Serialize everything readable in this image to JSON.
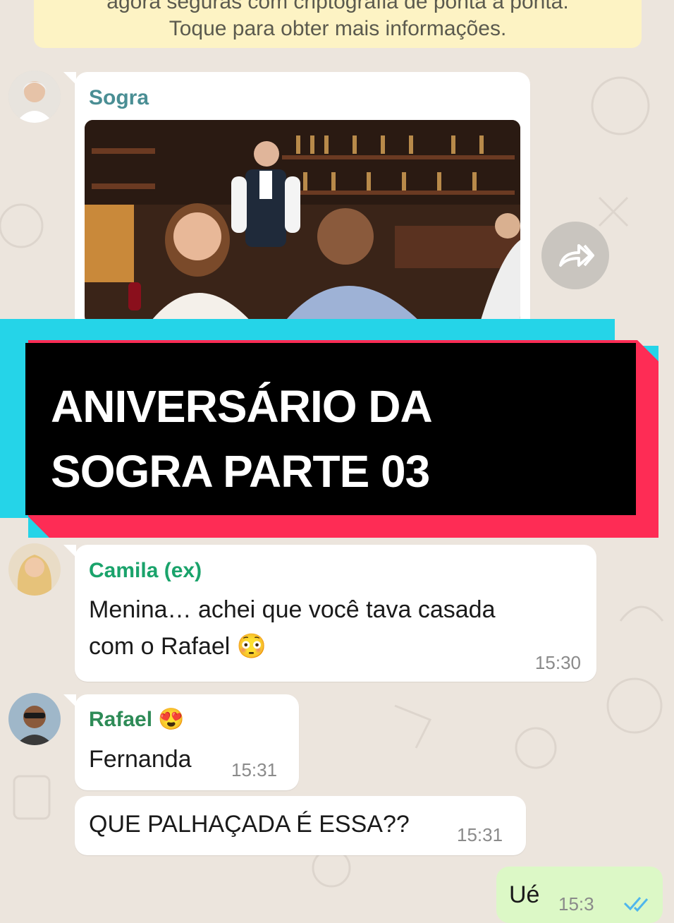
{
  "notice": {
    "line1": "agora seguras com criptografia de ponta a ponta.",
    "line2": "Toque para obter mais informações."
  },
  "messages": [
    {
      "sender": "Sogra",
      "type": "image"
    },
    {
      "sender": "Camila (ex)",
      "text_line1": "Menina… achei que você tava casada",
      "text_line2": "com o Rafael 😳",
      "time": "15:30"
    },
    {
      "sender": "Rafael 😍",
      "text": "Fernanda",
      "time": "15:31"
    },
    {
      "text": "QUE PALHAÇADA É ESSA??",
      "time": "15:31"
    },
    {
      "text": "Ué",
      "time": "15:3"
    }
  ],
  "banner": {
    "line1": "ANIVERSÁRIO DA",
    "line2": "SOGRA PARTE 03"
  },
  "colors": {
    "background": "#ece5dd",
    "sender_sogra": "#4a8e94",
    "sender_camila": "#1aa36b",
    "sender_rafael": "#2e8b57",
    "banner_black": "#000000",
    "banner_cyan": "#25d4e8",
    "banner_pink": "#fe2c55",
    "outgoing": "#dcf8c6"
  },
  "icons": [
    "forward-icon",
    "double-check-icon"
  ]
}
